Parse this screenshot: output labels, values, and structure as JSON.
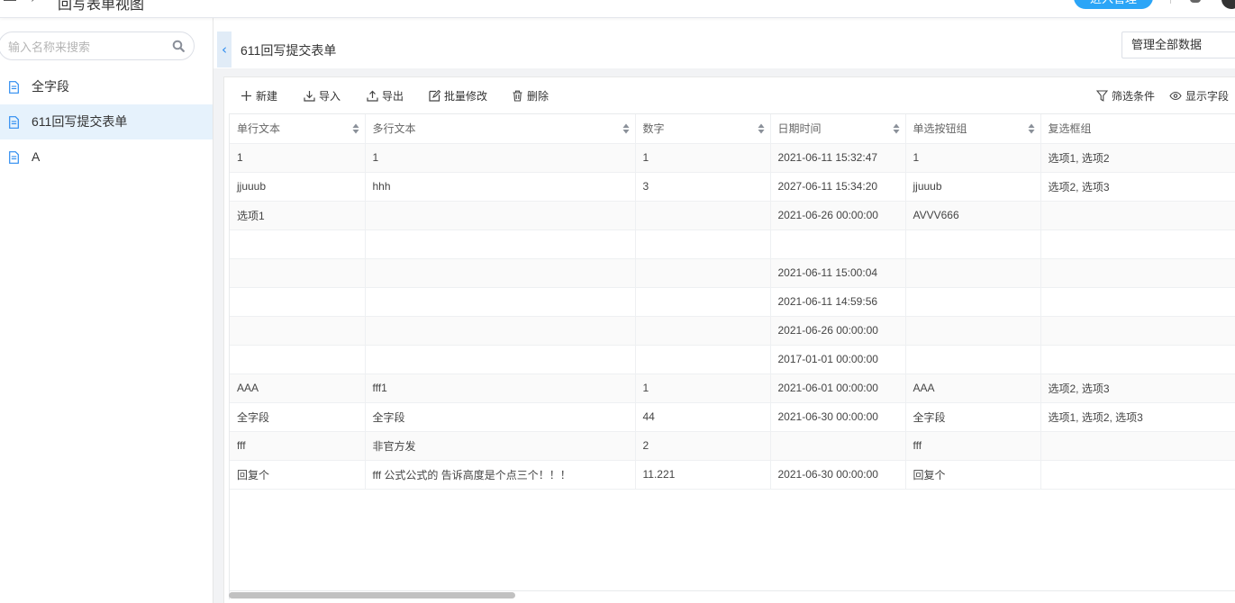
{
  "header": {
    "app_title": "回写表单视图",
    "top_button_label": "进入管理"
  },
  "sidebar": {
    "search_placeholder": "输入名称来搜索",
    "items": [
      {
        "label": "全字段",
        "active": false
      },
      {
        "label": "611回写提交表单",
        "active": true
      },
      {
        "label": "A",
        "active": false
      }
    ]
  },
  "main": {
    "page_title": "611回写提交表单",
    "scope_select_value": "管理全部数据",
    "toolbar": {
      "new_label": "新建",
      "import_label": "导入",
      "export_label": "导出",
      "batch_edit_label": "批量修改",
      "delete_label": "删除",
      "filter_label": "筛选条件",
      "show_fields_label": "显示字段"
    },
    "table": {
      "columns": [
        "单行文本",
        "多行文本",
        "数字",
        "日期时间",
        "单选按钮组",
        "复选框组"
      ],
      "rows": [
        [
          "1",
          "1",
          "1",
          "2021-06-11 15:32:47",
          "1",
          "选项1, 选项2"
        ],
        [
          "jjuuub",
          "hhh",
          "3",
          "2027-06-11 15:34:20",
          "jjuuub",
          "选项2, 选项3"
        ],
        [
          "选项1",
          "",
          "",
          "2021-06-26 00:00:00",
          "AVVV666",
          ""
        ],
        [
          "",
          "",
          "",
          "",
          "",
          ""
        ],
        [
          "",
          "",
          "",
          "2021-06-11 15:00:04",
          "",
          ""
        ],
        [
          "",
          "",
          "",
          "2021-06-11 14:59:56",
          "",
          ""
        ],
        [
          "",
          "",
          "",
          "2021-06-26 00:00:00",
          "",
          ""
        ],
        [
          "",
          "",
          "",
          "2017-01-01 00:00:00",
          "",
          ""
        ],
        [
          "AAA",
          "fff1",
          "1",
          "2021-06-01 00:00:00",
          "AAA",
          "选项2, 选项3"
        ],
        [
          "全字段",
          "全字段",
          "44",
          "2021-06-30 00:00:00",
          "全字段",
          "选项1, 选项2, 选项3"
        ],
        [
          "fff",
          "非官方发",
          "2",
          "",
          "fff",
          ""
        ],
        [
          "回复个",
          "fff 公式公式的 告诉高度是个点三个！！！",
          "11.221",
          "2021-06-30 00:00:00",
          "回复个",
          ""
        ]
      ]
    }
  },
  "colors": {
    "accent": "#2d8cf0",
    "active_item_bg": "#e6f2fc",
    "page_bg": "#f2f3f5"
  }
}
